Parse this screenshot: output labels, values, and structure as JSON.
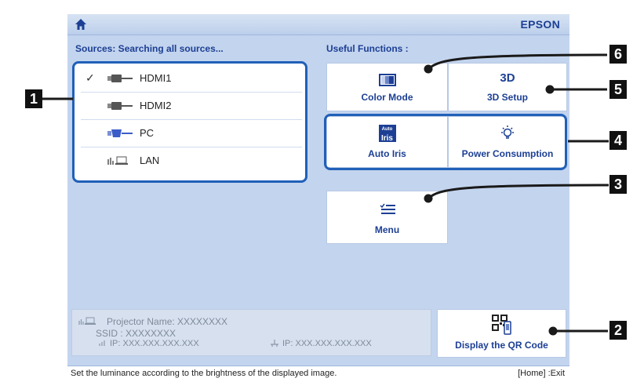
{
  "header": {
    "brand": "EPSON"
  },
  "sources": {
    "label": "Sources: Searching all sources...",
    "items": [
      {
        "check": "✓",
        "label": "HDMI1",
        "icon": "hdmi-icon"
      },
      {
        "check": "",
        "label": "HDMI2",
        "icon": "hdmi-icon"
      },
      {
        "check": "",
        "label": "PC",
        "icon": "vga-icon"
      },
      {
        "check": "",
        "label": "LAN",
        "icon": "lan-icon"
      }
    ]
  },
  "functions": {
    "label": "Useful Functions :",
    "color_mode": "Color Mode",
    "setup_3d": "3D Setup",
    "setup_3d_icon_text": "3D",
    "auto_iris": "Auto Iris",
    "auto_iris_icon_top": "Auto",
    "auto_iris_icon_bottom": "Iris",
    "power": "Power Consumption",
    "menu": "Menu"
  },
  "network": {
    "projector_name": "Projector Name:  XXXXXXXX",
    "ssid": "SSID :  XXXXXXXX",
    "ip_wireless": "IP:  XXX.XXX.XXX.XXX",
    "ip_wired": "IP:  XXX.XXX.XXX.XXX"
  },
  "qr": {
    "label": "Display the QR Code"
  },
  "status": {
    "message": "Set the luminance according to the brightness of the displayed image.",
    "exit": "[Home] :Exit"
  },
  "callouts": [
    "1",
    "2",
    "3",
    "4",
    "5",
    "6"
  ],
  "colors": {
    "accent": "#1c3f94",
    "highlight": "#2060b8",
    "background": "#c3d4ee"
  }
}
